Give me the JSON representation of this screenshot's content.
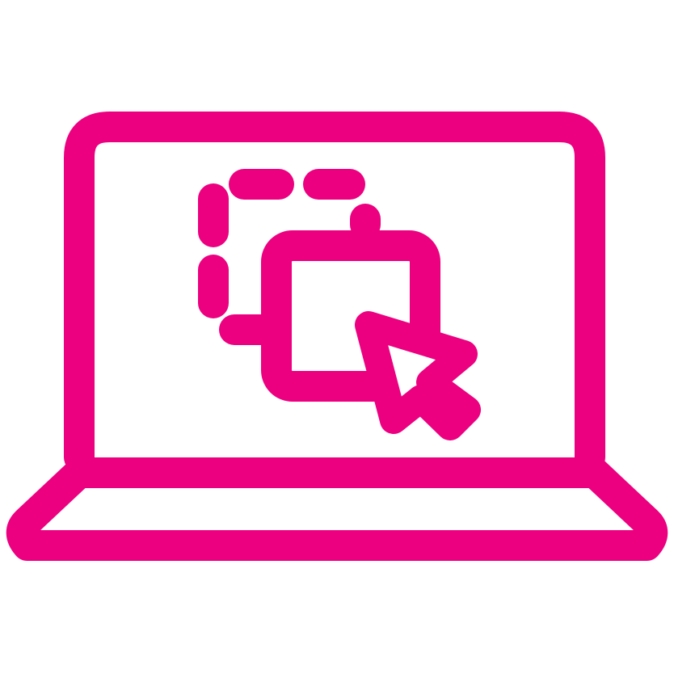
{
  "icon": {
    "name": "laptop-drag-drop-icon",
    "parts": [
      "laptop-icon",
      "dashed-selection-icon",
      "square-icon",
      "cursor-arrow-icon"
    ],
    "accent_color": "#ec0080",
    "background_color": "#ffffff"
  }
}
